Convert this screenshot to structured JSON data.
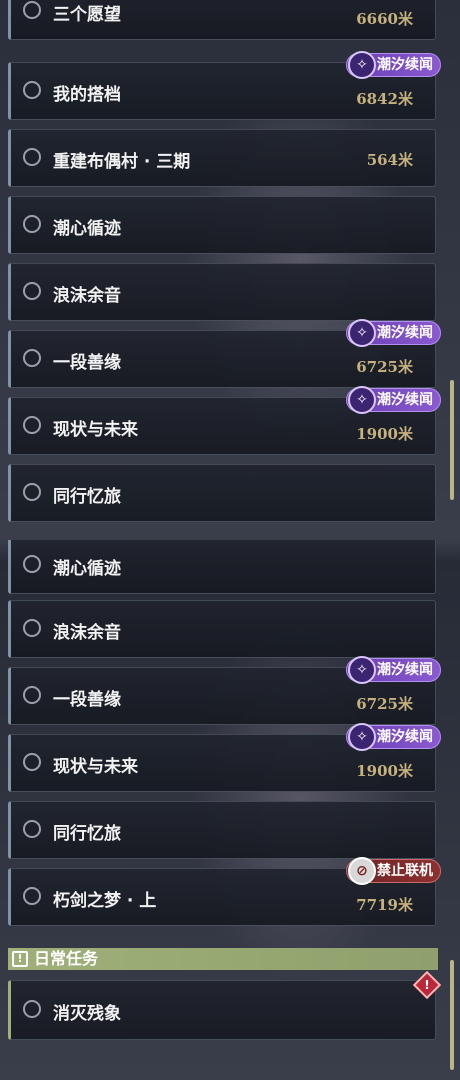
{
  "badges": {
    "tide": "潮汐续闻",
    "no_coop": "禁止联机"
  },
  "panel_top": {
    "quests": [
      {
        "title": "三个愿望",
        "distance": "6660米"
      },
      {
        "title": "我的搭档",
        "distance": "6842米"
      },
      {
        "title": "重建布偶村 · 三期",
        "distance": "564米"
      },
      {
        "title": "潮心循迹"
      },
      {
        "title": "浪沫余音"
      },
      {
        "title": "一段善缘",
        "distance": "6725米"
      },
      {
        "title": "现状与未来",
        "distance": "1900米"
      },
      {
        "title": "同行忆旅"
      }
    ]
  },
  "panel_bottom": {
    "quests": [
      {
        "title": "潮心循迹"
      },
      {
        "title": "浪沫余音"
      },
      {
        "title": "一段善缘",
        "distance": "6725米"
      },
      {
        "title": "现状与未来",
        "distance": "1900米"
      },
      {
        "title": "同行忆旅"
      },
      {
        "title": "朽剑之梦 · 上",
        "distance": "7719米"
      }
    ],
    "daily_section": {
      "title": "日常任务",
      "quests": [
        {
          "title": "消灭残象"
        }
      ]
    }
  },
  "colors": {
    "accent_gold": "#c6b27e",
    "tide_purple": "#7b4cc4",
    "daily_green": "#9fb07a",
    "no_coop_red": "#8e3030"
  }
}
